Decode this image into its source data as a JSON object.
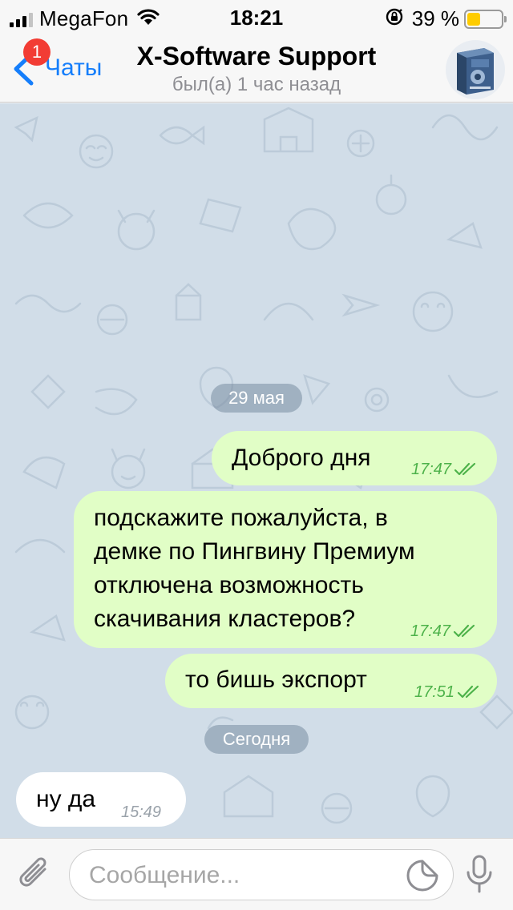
{
  "status_bar": {
    "carrier": "MegaFon",
    "time": "18:21",
    "battery_percent": "39 %",
    "battery_level": 0.39,
    "signal_bars_filled": 3,
    "icons": [
      "cellular-signal-icon",
      "wifi-icon",
      "rotation-lock-icon",
      "battery-icon"
    ]
  },
  "header": {
    "back_label": "Чаты",
    "unread_badge": "1",
    "title": "X-Software Support",
    "subtitle": "был(а) 1 час назад",
    "icons": [
      "chevron-left-icon",
      "contact-avatar"
    ]
  },
  "chat": {
    "date_separators": [
      "29 мая",
      "Сегодня"
    ],
    "messages": [
      {
        "direction": "outgoing",
        "text": "Доброго дня",
        "time": "17:47",
        "status": "read"
      },
      {
        "direction": "outgoing",
        "lines": [
          "подскажите пожалуйста, в",
          "демке по Пингвину Премиум",
          "отключена возможность",
          "скачивания кластеров?"
        ],
        "time": "17:47",
        "status": "read"
      },
      {
        "direction": "outgoing",
        "text": "то бишь экспорт",
        "time": "17:51",
        "status": "read"
      },
      {
        "direction": "incoming",
        "text": "ну да",
        "time": "15:49"
      }
    ]
  },
  "composer": {
    "placeholder": "Сообщение...",
    "value": "",
    "icons": [
      "paperclip-icon",
      "sticker-icon",
      "microphone-icon"
    ]
  },
  "colors": {
    "accent": "#157efb",
    "badge": "#f23c34",
    "chat_background": "#d1dde8",
    "outgoing_bubble": "#e1fec6",
    "incoming_bubble": "#ffffff",
    "read_check": "#4db24a",
    "battery_fill": "#ffcc00"
  }
}
